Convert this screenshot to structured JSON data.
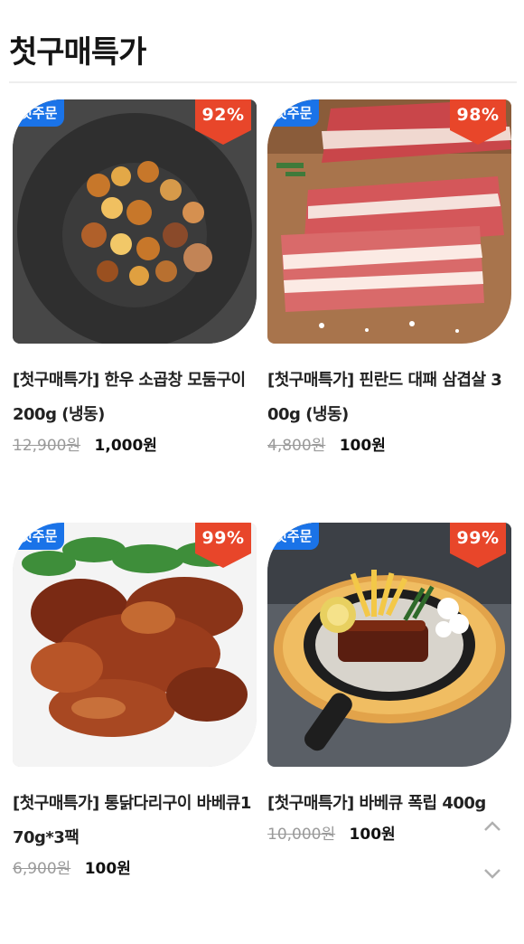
{
  "section": {
    "title": "첫구매특가"
  },
  "tag_label": "첫주문",
  "colors": {
    "tag_bg": "#1a73e8",
    "discount_bg": "#e8462a"
  },
  "products": [
    {
      "name": "[첫구매특가] 한우 소곱창 모둠구이 200g (냉동)",
      "original_price": "12,900원",
      "sale_price": "1,000원",
      "discount": "92%"
    },
    {
      "name": "[첫구매특가] 핀란드 대패 삼겹살 300g (냉동)",
      "original_price": "4,800원",
      "sale_price": "100원",
      "discount": "98%"
    },
    {
      "name": "[첫구매특가] 통닭다리구이 바베큐170g*3팩",
      "original_price": "6,900원",
      "sale_price": "100원",
      "discount": "99%"
    },
    {
      "name": "[첫구매특가] 바베큐 폭립 400g",
      "original_price": "10,000원",
      "sale_price": "100원",
      "discount": "99%"
    }
  ],
  "scroll": {
    "up_icon": "chevron-up-icon",
    "down_icon": "chevron-down-icon"
  }
}
